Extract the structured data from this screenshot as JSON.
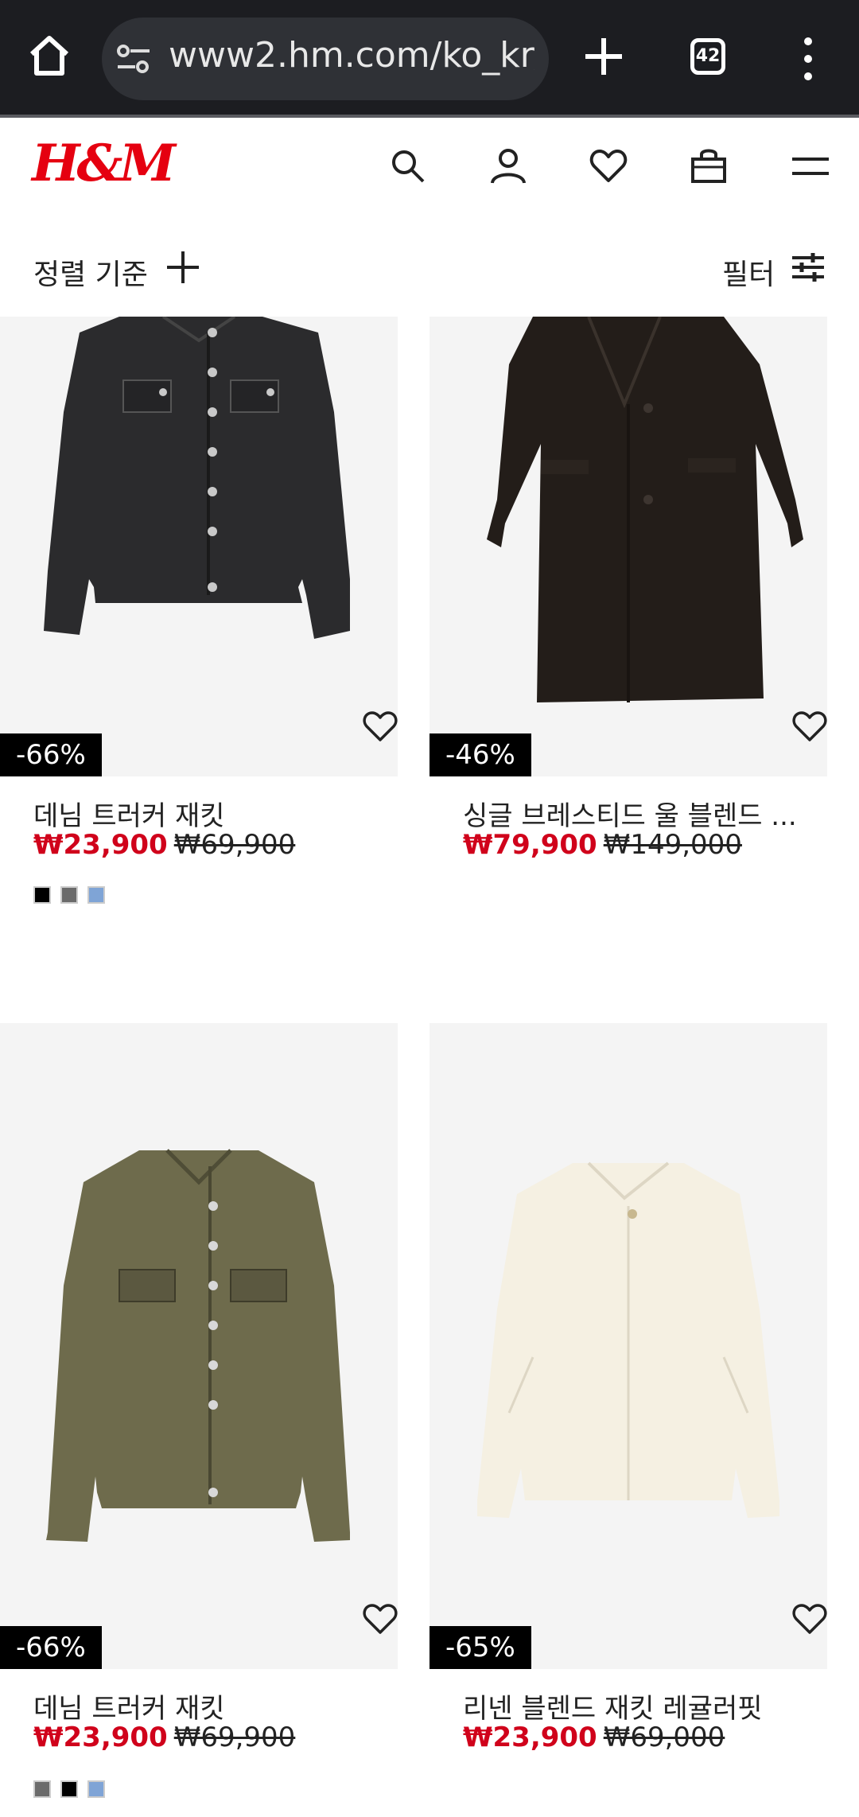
{
  "browser": {
    "url": "www2.hm.com/ko_kr/",
    "tab_count": "42"
  },
  "header": {
    "logo": "H&M"
  },
  "toolbar": {
    "sort_label": "정렬 기준",
    "filter_label": "필터"
  },
  "products": [
    {
      "name": "데님 트러커 재킷",
      "sale_price": "₩23,900",
      "original_price": "₩69,900",
      "discount": "-66%",
      "swatches": [
        "#000000",
        "#6b6b6b",
        "#7fa4d6"
      ]
    },
    {
      "name": "싱글 브레스티드 울 블렌드 ...",
      "sale_price": "₩79,900",
      "original_price": "₩149,000",
      "discount": "-46%",
      "swatches": []
    },
    {
      "name": "데님 트러커 재킷",
      "sale_price": "₩23,900",
      "original_price": "₩69,900",
      "discount": "-66%",
      "swatches": [
        "#6b6b6b",
        "#000000",
        "#7fa4d6"
      ]
    },
    {
      "name": "리넨 블렌드 재킷 레귤러핏",
      "sale_price": "₩23,900",
      "original_price": "₩69,000",
      "discount": "-65%",
      "swatches": []
    }
  ],
  "colors": {
    "brand": "#e50010",
    "sale": "#d0021b",
    "chrome_bg": "#1c1d21"
  }
}
